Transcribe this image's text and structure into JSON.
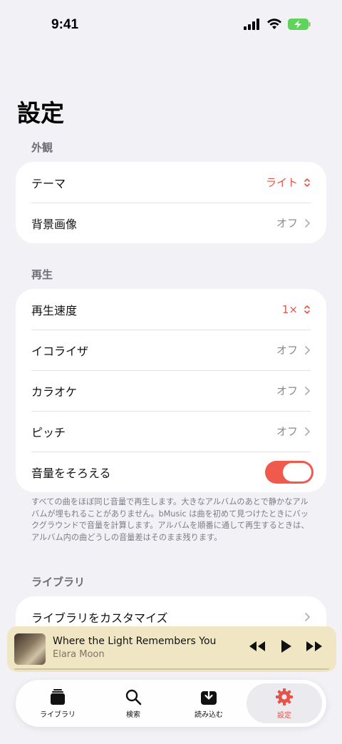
{
  "status_bar": {
    "time": "9:41"
  },
  "page": {
    "title": "設定"
  },
  "sections": {
    "appearance": {
      "header": "外観",
      "theme": {
        "label": "テーマ",
        "value": "ライト"
      },
      "background_image": {
        "label": "背景画像",
        "value": "オフ"
      }
    },
    "playback": {
      "header": "再生",
      "speed": {
        "label": "再生速度",
        "value": "1×"
      },
      "equalizer": {
        "label": "イコライザ",
        "value": "オフ"
      },
      "karaoke": {
        "label": "カラオケ",
        "value": "オフ"
      },
      "pitch": {
        "label": "ピッチ",
        "value": "オフ"
      },
      "normalize": {
        "label": "音量をそろえる",
        "enabled": true
      },
      "footnote": "すべての曲をほぼ同じ音量で再生します。大きなアルバムのあとで静かなアルバムが埋もれることがありません。bMusic は曲を初めて見つけたときにバックグラウンドで音量を計算します。アルバムを順番に通して再生するときは、アルバム内の曲どうしの音量差はそのまま残ります。"
    },
    "library": {
      "header": "ライブラリ",
      "customize": {
        "label": "ライブラリをカスタマイズ"
      }
    }
  },
  "mini_player": {
    "title": "Where the Light Remembers You",
    "artist": "Elara Moon"
  },
  "tab_bar": {
    "tabs": [
      {
        "label": "ライブラリ",
        "icon": "library-icon"
      },
      {
        "label": "検索",
        "icon": "search-icon"
      },
      {
        "label": "読み込む",
        "icon": "import-icon"
      },
      {
        "label": "設定",
        "icon": "gear-icon",
        "active": true
      }
    ]
  },
  "colors": {
    "accent": "#e5544a",
    "background": "#f2f1f6",
    "mini_player": "#f0e6c4"
  }
}
